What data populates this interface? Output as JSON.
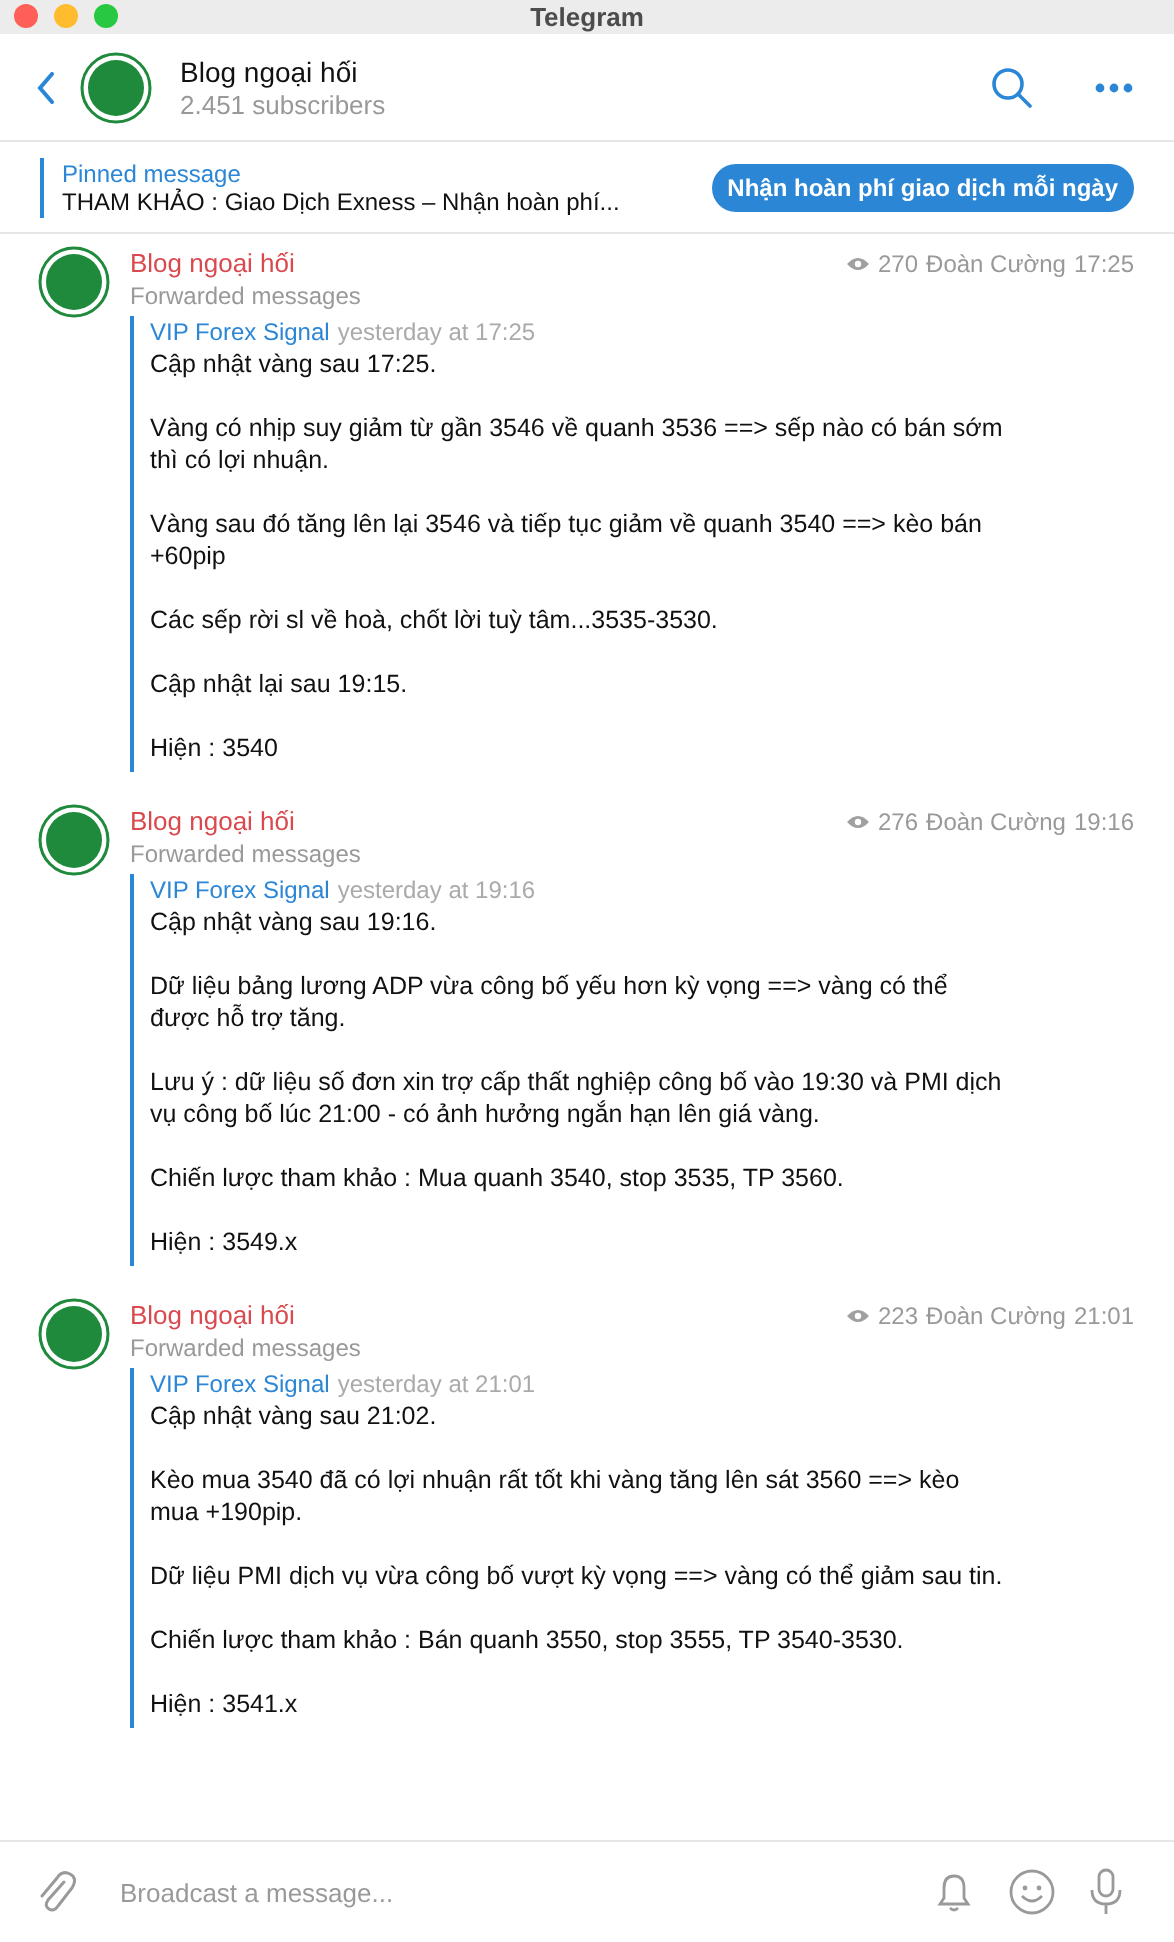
{
  "window": {
    "title": "Telegram"
  },
  "header": {
    "channel_name": "Blog ngoại hối",
    "subscribers": "2.451 subscribers"
  },
  "pinned": {
    "label": "Pinned message",
    "text": "THAM KHẢO : Giao Dịch Exness – Nhận hoàn phí...",
    "button": "Nhận hoàn phí giao dịch mỗi ngày"
  },
  "messages": [
    {
      "sender": "Blog ngoại hối",
      "subtitle": "Forwarded messages",
      "views": "270",
      "author": "Đoàn Cường",
      "time": "17:25",
      "forward_from": "VIP Forex Signal",
      "forward_time": "yesterday at 17:25",
      "paragraphs": [
        "Cập nhật vàng sau 17:25.",
        "Vàng có nhịp suy giảm từ gần 3546 về quanh 3536 ==> sếp nào có bán sớm thì có lợi nhuận.",
        "Vàng sau đó tăng lên lại 3546 và tiếp tục giảm về quanh 3540  ==> kèo bán +60pip",
        "Các sếp rời sl về hoà, chốt lời tuỳ tâm...3535-3530.",
        "Cập nhật lại sau 19:15.",
        "Hiện : 3540"
      ]
    },
    {
      "sender": "Blog ngoại hối",
      "subtitle": "Forwarded messages",
      "views": "276",
      "author": "Đoàn Cường",
      "time": "19:16",
      "forward_from": "VIP Forex Signal",
      "forward_time": "yesterday at 19:16",
      "paragraphs": [
        "Cập nhật vàng sau 19:16.",
        "Dữ liệu bảng lương ADP vừa công bố yếu hơn kỳ vọng ==> vàng có thể được hỗ trợ tăng.",
        "Lưu ý : dữ liệu số đơn xin trợ cấp thất nghiệp công bố vào 19:30 và PMI dịch vụ công bố lúc 21:00 - có ảnh hưởng ngắn hạn lên giá vàng.",
        "Chiến lược tham khảo : Mua quanh 3540, stop 3535, TP 3560.",
        "Hiện : 3549.x"
      ]
    },
    {
      "sender": "Blog ngoại hối",
      "subtitle": "Forwarded messages",
      "views": "223",
      "author": "Đoàn Cường",
      "time": "21:01",
      "forward_from": "VIP Forex Signal",
      "forward_time": "yesterday at 21:01",
      "paragraphs": [
        "Cập nhật vàng sau 21:02.",
        "Kèo mua 3540 đã có lợi nhuận rất tốt khi vàng tăng lên sát 3560 ==> kèo mua +190pip.",
        "Dữ liệu PMI dịch vụ vừa công bố vượt kỳ vọng ==> vàng có thể giảm sau tin.",
        "Chiến lược tham khảo : Bán quanh 3550, stop 3555, TP 3540-3530.",
        "Hiện : 3541.x"
      ]
    }
  ],
  "composer": {
    "placeholder": "Broadcast a message..."
  }
}
